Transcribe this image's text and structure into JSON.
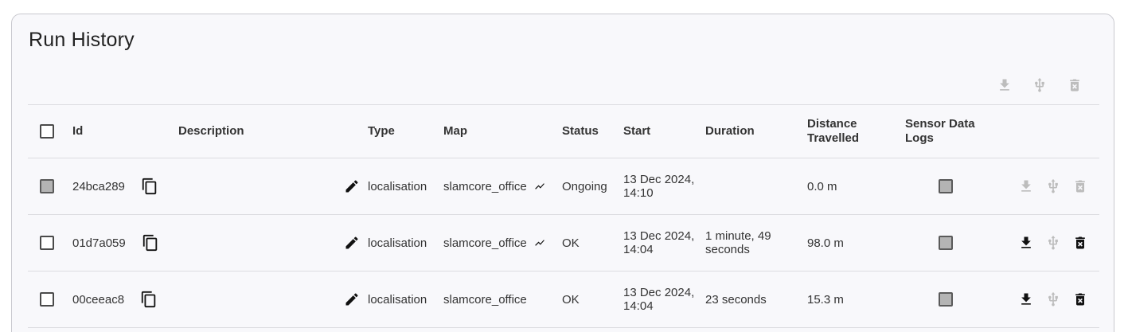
{
  "panel": {
    "title": "Run History",
    "toolbar": {
      "download_icon": "download-icon",
      "usb_icon": "usb-icon",
      "delete_icon": "delete-icon",
      "state": "disabled"
    }
  },
  "table": {
    "headers": {
      "id": "Id",
      "description": "Description",
      "type": "Type",
      "map": "Map",
      "status": "Status",
      "start": "Start",
      "duration": "Duration",
      "distance_line1": "Distance",
      "distance_line2": "Travelled",
      "sensor_line1": "Sensor Data",
      "sensor_line2": "Logs"
    },
    "rows": [
      {
        "id": "24bca289",
        "description": "",
        "type": "localisation",
        "map": "slamcore_office",
        "has_trend_icon": true,
        "status": "Ongoing",
        "start_line1": "13 Dec 2024,",
        "start_line2": "14:10",
        "duration_line1": "",
        "duration_line2": "",
        "distance": "0.0 m",
        "select_checked_disabled": true,
        "actions_enabled": false
      },
      {
        "id": "01d7a059",
        "description": "",
        "type": "localisation",
        "map": "slamcore_office",
        "has_trend_icon": true,
        "status": "OK",
        "start_line1": "13 Dec 2024,",
        "start_line2": "14:04",
        "duration_line1": "1 minute, 49",
        "duration_line2": "seconds",
        "distance": "98.0 m",
        "select_checked_disabled": false,
        "actions_enabled": true
      },
      {
        "id": "00ceeac8",
        "description": "",
        "type": "localisation",
        "map": "slamcore_office",
        "has_trend_icon": false,
        "status": "OK",
        "start_line1": "13 Dec 2024,",
        "start_line2": "14:04",
        "duration_line1": "23 seconds",
        "duration_line2": "",
        "distance": "15.3 m",
        "select_checked_disabled": false,
        "actions_enabled": true
      }
    ]
  },
  "colors": {
    "disabled_icon": "#bdbdbd",
    "enabled_icon": "#111111",
    "panel_bg": "#f8f8fb"
  }
}
